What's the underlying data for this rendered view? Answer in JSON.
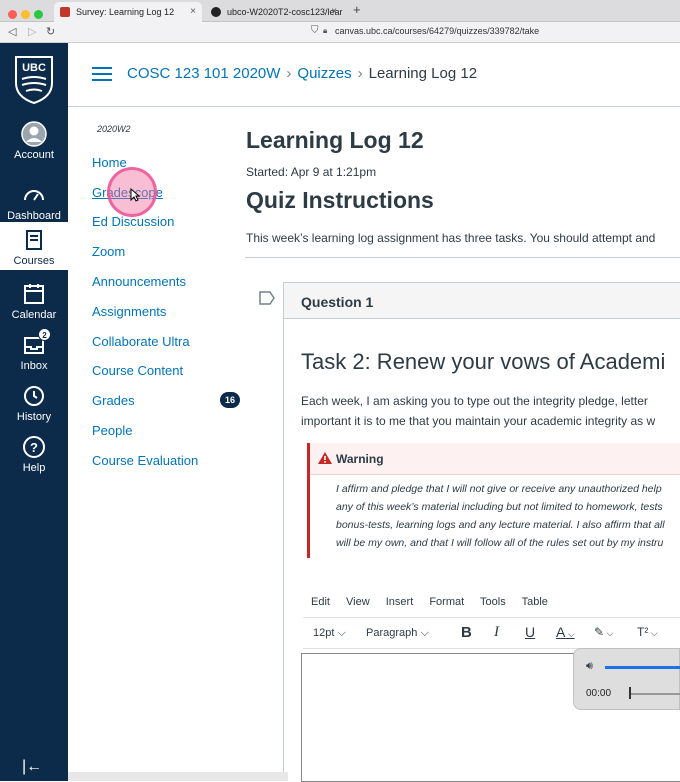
{
  "browser": {
    "tabs": [
      {
        "label": "Survey: Learning Log 12",
        "close": "×"
      },
      {
        "label": "ubco-W2020T2-cosc123/learning-...",
        "close": "×"
      }
    ],
    "new_tab": "+",
    "url": "canvas.ubc.ca/courses/64279/quizzes/339782/take"
  },
  "global_nav": {
    "logo": "UBC",
    "items": [
      {
        "label": "Account"
      },
      {
        "label": "Dashboard"
      },
      {
        "label": "Courses"
      },
      {
        "label": "Calendar"
      },
      {
        "label": "Inbox",
        "badge": "2"
      },
      {
        "label": "History"
      },
      {
        "label": "Help"
      }
    ],
    "collapse": "|←"
  },
  "breadcrumbs": {
    "course": "COSC 123 101 2020W",
    "section": "Quizzes",
    "current": "Learning Log 12",
    "sep": "›"
  },
  "course_nav": {
    "term": "2020W2",
    "items": [
      "Home",
      "Gradescope",
      "Ed Discussion",
      "Zoom",
      "Announcements",
      "Assignments",
      "Collaborate Ultra",
      "Course Content",
      "Grades",
      "People",
      "Course Evaluation"
    ],
    "grades_badge": "16"
  },
  "quiz": {
    "title": "Learning Log 12",
    "started": "Started: Apr 9 at 1:21pm",
    "instructions_heading": "Quiz Instructions",
    "instructions_text": "This week’s learning log assignment has three tasks. You should attempt and",
    "question_label": "Question 1",
    "task_heading": "Task 2: Renew your vows of Academi",
    "para_line1": "Each week, I am asking you to type out the integrity pledge, letter",
    "para_line2": "important it is to me that you maintain your academic integrity as w",
    "warning_title": "Warning",
    "warning_lines": [
      "I affirm and pledge that I will not give or receive any unauthorized help",
      "any of this week’s material including but not limited to homework, tests",
      "bonus-tests, learning logs and any lecture material. I also affirm that all",
      "will be my own, and that I will follow all of the rules set out by my instru"
    ]
  },
  "editor": {
    "menu": [
      "Edit",
      "View",
      "Insert",
      "Format",
      "Tools",
      "Table"
    ],
    "font_size": "12pt",
    "block_format": "Paragraph",
    "bold": "B",
    "italic": "I",
    "underline": "U",
    "text_color": "A",
    "superscript": "T²"
  },
  "media_player": {
    "time": "00:00"
  }
}
